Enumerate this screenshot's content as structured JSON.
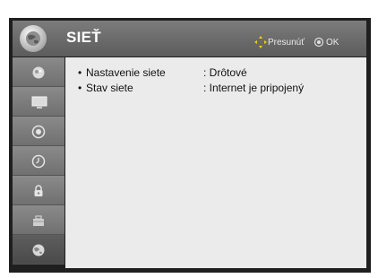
{
  "header": {
    "title": "SIEŤ",
    "hint_move": "Presunúť",
    "hint_ok": "OK",
    "logo_icon": "network-globe-icon"
  },
  "sidebar": {
    "items": [
      {
        "icon": "picture-icon"
      },
      {
        "icon": "monitor-icon"
      },
      {
        "icon": "audio-icon"
      },
      {
        "icon": "clock-icon"
      },
      {
        "icon": "lock-icon"
      },
      {
        "icon": "options-icon"
      },
      {
        "icon": "network-icon",
        "active": true
      }
    ]
  },
  "settings": [
    {
      "bullet": "•",
      "label": "Nastavenie siete",
      "value": ": Drôtové"
    },
    {
      "bullet": "•",
      "label": "Stav siete",
      "value": ": Internet je pripojený"
    }
  ],
  "colors": {
    "header": "#6a6a6a",
    "sidebar": "#7a7a7a",
    "content": "#ebebeb",
    "frame": "#1f1f1f"
  }
}
